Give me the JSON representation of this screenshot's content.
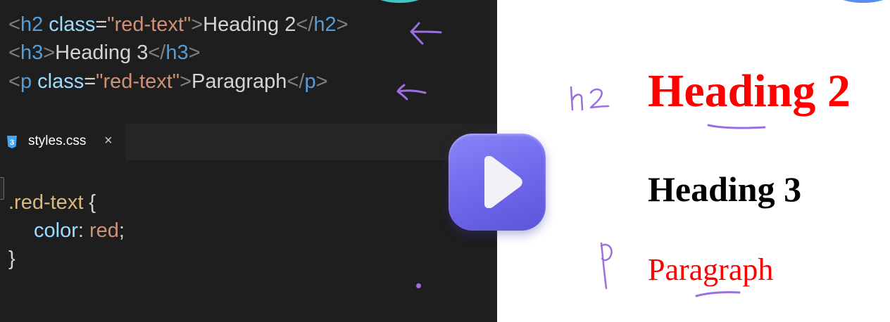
{
  "html_code": {
    "line1": {
      "open_lt": "<",
      "tag": "h2",
      "attr": " class",
      "eq": "=",
      "val": "\"red-text\"",
      "gt": ">",
      "text": "Heading 2",
      "close_lt": "</",
      "close_tag": "h2",
      "close_gt": ">"
    },
    "line2": {
      "open_lt": "<",
      "tag": "h3",
      "gt": ">",
      "text": "Heading 3",
      "close_lt": "</",
      "close_tag": "h3",
      "close_gt": ">"
    },
    "line3": {
      "open_lt": "<",
      "tag": "p",
      "attr": " class",
      "eq": "=",
      "val": "\"red-text\"",
      "gt": ">",
      "text": "Paragraph",
      "close_lt": "</",
      "close_tag": "p",
      "close_gt": ">"
    }
  },
  "tab": {
    "label": "styles.css",
    "close": "×"
  },
  "css_code": {
    "selector": ".red-text",
    "brace_open": " {",
    "property": "color",
    "colon": ": ",
    "value": "red",
    "semicolon": ";",
    "brace_close": "}"
  },
  "preview": {
    "h2": "Heading 2",
    "h3": "Heading 3",
    "p": "Paragraph"
  },
  "annotations": {
    "h2_note": "h2",
    "p_note": "p"
  },
  "colors": {
    "editor_bg": "#1e1e1e",
    "tag": "#569cd6",
    "attr": "#9cdcfe",
    "string": "#ce9178",
    "selector": "#d7ba7d",
    "play_button": "#726cf0",
    "annotation_purple": "#9b6fe0",
    "preview_red": "#ff0000"
  },
  "icons": {
    "play": "play-icon",
    "css_file": "css3-icon",
    "close": "close-icon"
  }
}
